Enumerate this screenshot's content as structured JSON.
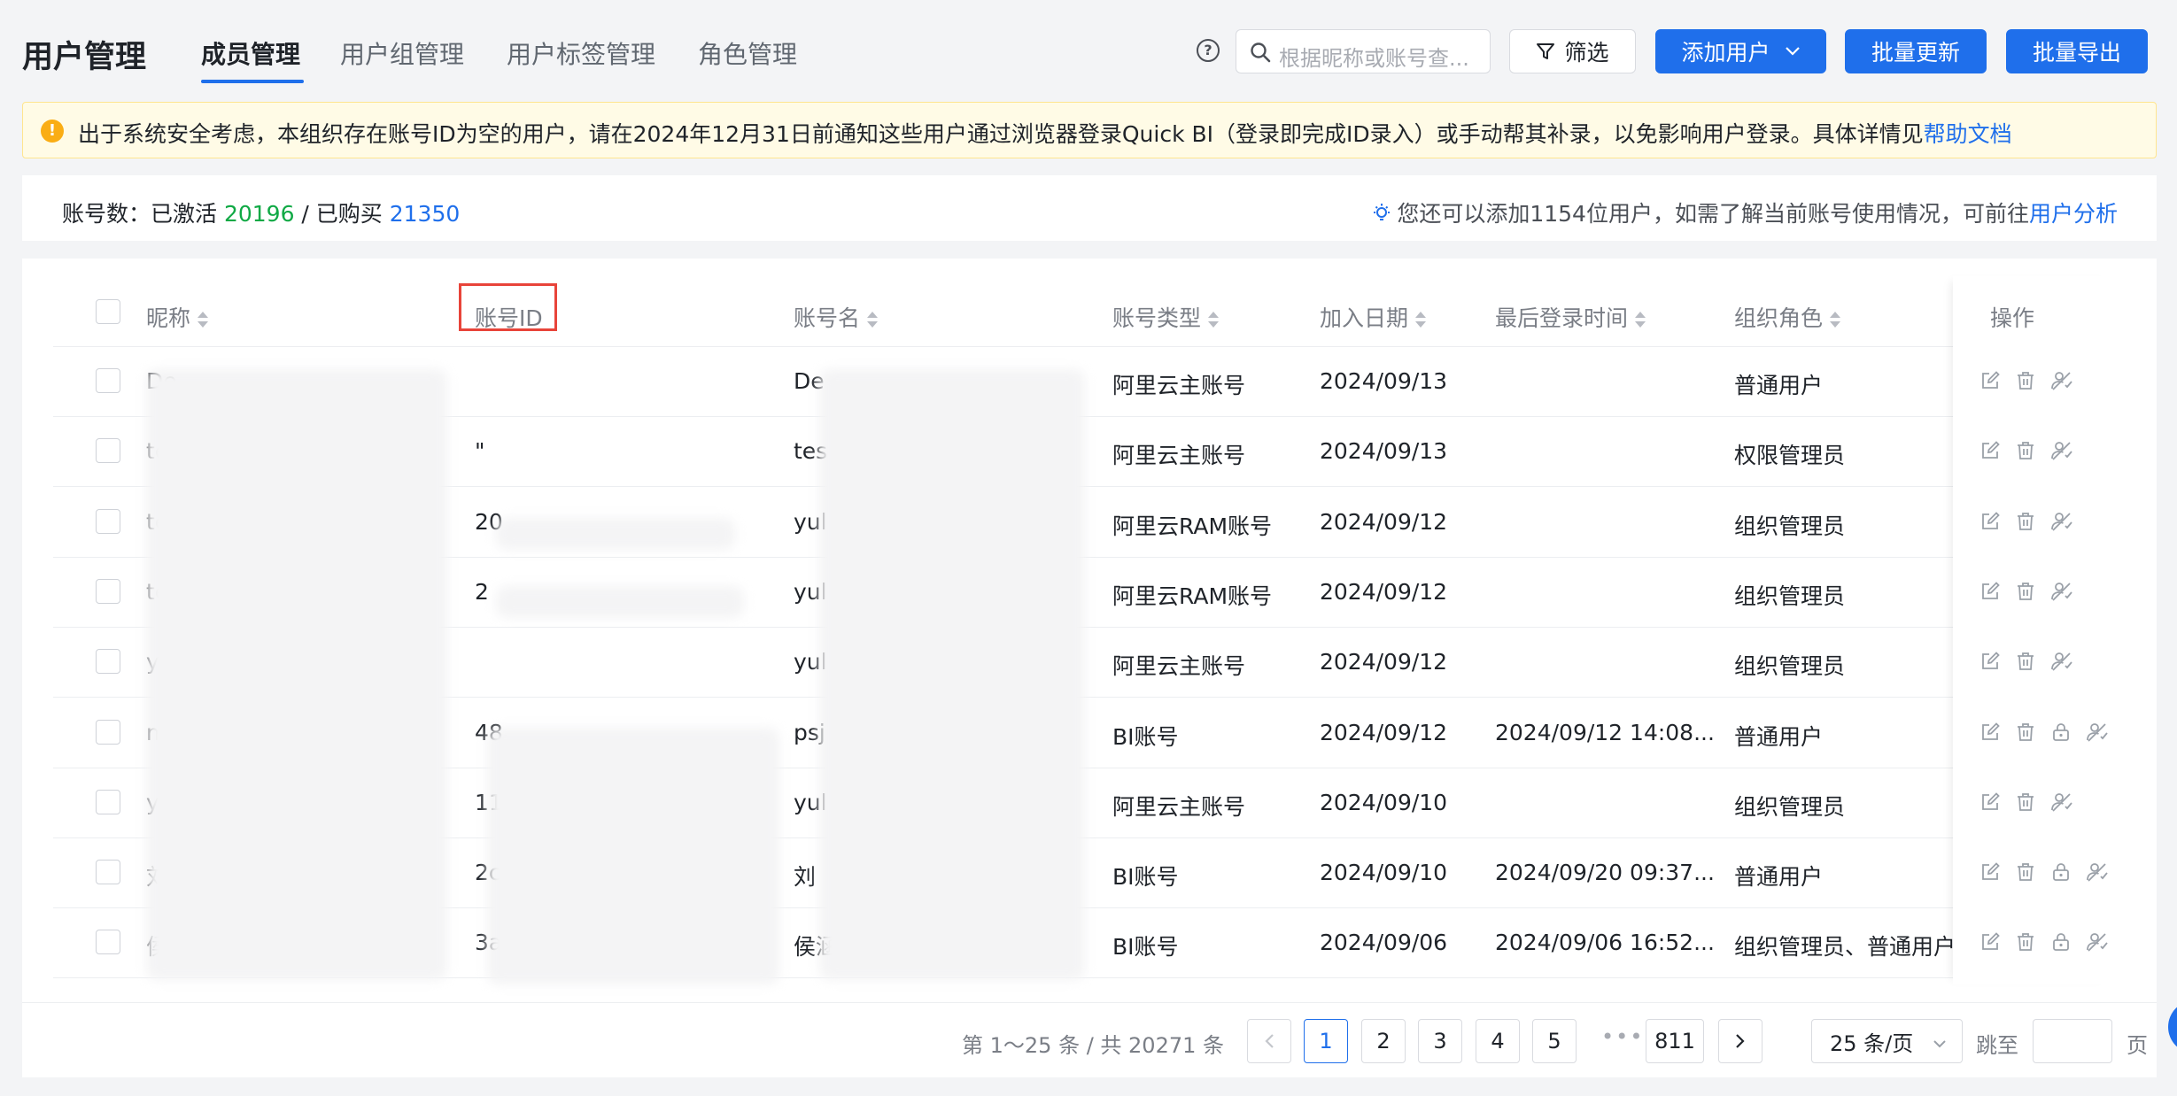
{
  "header": {
    "title": "用户管理",
    "tabs": [
      {
        "label": "成员管理",
        "active": true
      },
      {
        "label": "用户组管理",
        "active": false
      },
      {
        "label": "用户标签管理",
        "active": false
      },
      {
        "label": "角色管理",
        "active": false
      }
    ],
    "search_placeholder": "根据昵称或账号查...",
    "filter_label": "筛选",
    "add_user_label": "添加用户",
    "batch_update_label": "批量更新",
    "batch_export_label": "批量导出"
  },
  "notice": {
    "text": "出于系统安全考虑，本组织存在账号ID为空的用户，请在2024年12月31日前通知这些用户通过浏览器登录Quick BI（登录即完成ID录入）或手动帮其补录，以免影响用户登录。具体详情见",
    "link": "帮助文档"
  },
  "summary": {
    "prefix": "账号数：已激活 ",
    "activated": "20196",
    "separator": " / 已购买 ",
    "purchased": "21350",
    "hint": "您还可以添加1154位用户，如需了解当前账号使用情况，可前往",
    "hint_link": "用户分析"
  },
  "table": {
    "columns": [
      "昵称",
      "账号ID",
      "账号名",
      "账号类型",
      "加入日期",
      "最后登录时间",
      "组织角色",
      "操作"
    ],
    "rows": [
      {
        "nick": "De",
        "id": "",
        "name": "De",
        "type": "阿里云主账号",
        "date": "2024/09/13",
        "last": "",
        "role": "普通用户",
        "ops": 3
      },
      {
        "nick": "te",
        "id": "\"",
        "name": "tes",
        "type": "阿里云主账号",
        "date": "2024/09/13",
        "last": "",
        "role": "权限管理员",
        "ops": 3
      },
      {
        "nick": "te",
        "id": "20",
        "name": "yul",
        "type": "阿里云RAM账号",
        "date": "2024/09/12",
        "last": "",
        "role": "组织管理员",
        "ops": 3
      },
      {
        "nick": "te",
        "id": "2",
        "name": "yul",
        "type": "阿里云RAM账号",
        "date": "2024/09/12",
        "last": "",
        "role": "组织管理员",
        "ops": 3
      },
      {
        "nick": "yu",
        "id": "",
        "name": "yul",
        "type": "阿里云主账号",
        "date": "2024/09/12",
        "last": "",
        "role": "组织管理员",
        "ops": 3
      },
      {
        "nick": "m",
        "id": "48",
        "name": "psj",
        "type": "BI账号",
        "date": "2024/09/12",
        "last": "2024/09/12 14:08...",
        "role": "普通用户",
        "ops": 4
      },
      {
        "nick": "yu",
        "id": "11",
        "name": "yul",
        "type": "阿里云主账号",
        "date": "2024/09/10",
        "last": "",
        "role": "组织管理员",
        "ops": 3
      },
      {
        "nick": "刘",
        "id": "2c",
        "name": "刘",
        "type": "BI账号",
        "date": "2024/09/10",
        "last": "2024/09/20 09:37...",
        "role": "普通用户",
        "ops": 4
      },
      {
        "nick": "侯",
        "id": "3a",
        "name": "侯涵0412",
        "type": "BI账号",
        "date": "2024/09/06",
        "last": "2024/09/06 16:52...",
        "role": "组织管理员、普通用户",
        "ops": 4
      }
    ]
  },
  "pagination": {
    "total_text": "第 1～25 条 / 共 20271 条",
    "pages": [
      "1",
      "2",
      "3",
      "4",
      "5"
    ],
    "last_page": "811",
    "page_size": "25 条/页",
    "jump_label": "跳至",
    "jump_suffix": "页"
  }
}
